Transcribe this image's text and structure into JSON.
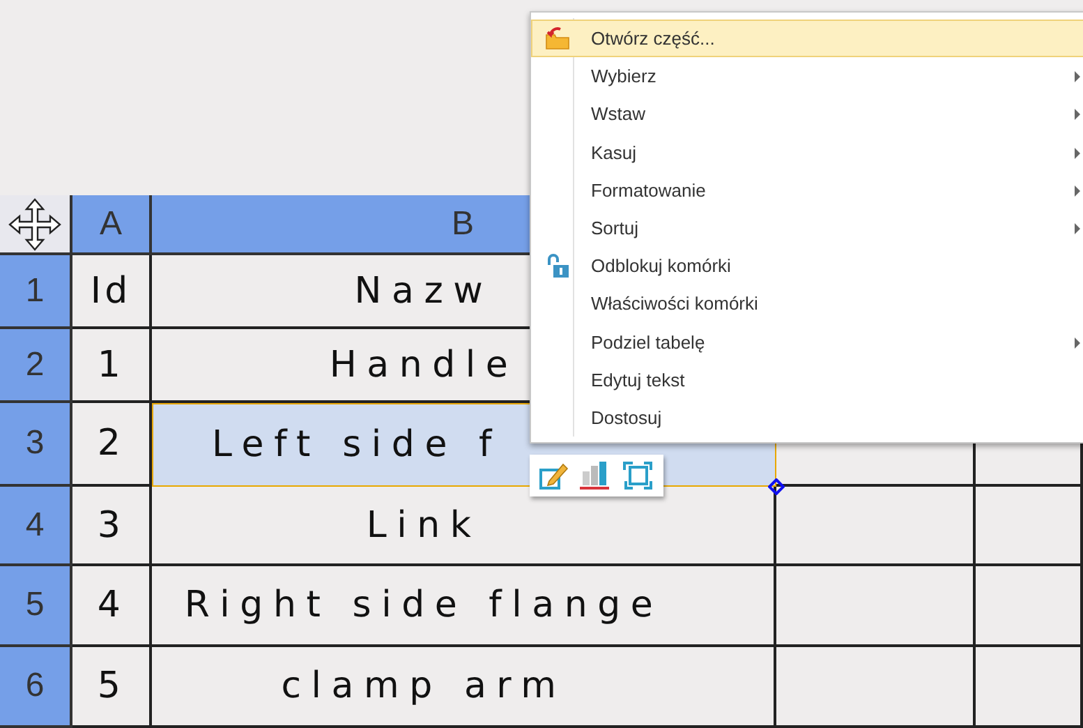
{
  "table": {
    "columns": [
      {
        "label": "A"
      },
      {
        "label": "B"
      }
    ],
    "rows": [
      {
        "number": "1",
        "cells": [
          {
            "text": "Id",
            "selected": false
          },
          {
            "text": "Nazw",
            "selected": false
          }
        ]
      },
      {
        "number": "2",
        "cells": [
          {
            "text": "1",
            "selected": false
          },
          {
            "text": "Handle",
            "selected": false
          }
        ]
      },
      {
        "number": "3",
        "cells": [
          {
            "text": "2",
            "selected": false
          },
          {
            "text": "Left side f",
            "selected": true
          }
        ]
      },
      {
        "number": "4",
        "cells": [
          {
            "text": "3",
            "selected": false
          },
          {
            "text": "Link",
            "selected": false
          }
        ]
      },
      {
        "number": "5",
        "cells": [
          {
            "text": "4",
            "selected": false
          },
          {
            "text": "Right side flange",
            "selected": false
          }
        ]
      },
      {
        "number": "6",
        "cells": [
          {
            "text": "5",
            "selected": false
          },
          {
            "text": "clamp arm",
            "selected": false
          }
        ]
      }
    ]
  },
  "context_menu": {
    "items": [
      {
        "label": "Otwórz część...",
        "selected": true,
        "has_submenu": false,
        "kind": "open"
      },
      {
        "label": "Wybierz",
        "selected": false,
        "has_submenu": true
      },
      {
        "label": "Wstaw",
        "selected": false,
        "has_submenu": true
      },
      {
        "label": "Kasuj",
        "selected": false,
        "has_submenu": true
      },
      {
        "label": "Formatowanie",
        "selected": false,
        "has_submenu": true
      },
      {
        "label": "Sortuj",
        "selected": false,
        "has_submenu": true
      },
      {
        "label": "Odblokuj komórki",
        "selected": false,
        "has_submenu": false,
        "kind": "unlock"
      },
      {
        "label": "Właściwości komórki",
        "selected": false,
        "has_submenu": false
      },
      {
        "label": "Podziel tabelę",
        "selected": false,
        "has_submenu": true
      },
      {
        "label": "Edytuj tekst",
        "selected": false,
        "has_submenu": false
      },
      {
        "label": "Dostosuj",
        "selected": false,
        "has_submenu": false
      }
    ]
  }
}
